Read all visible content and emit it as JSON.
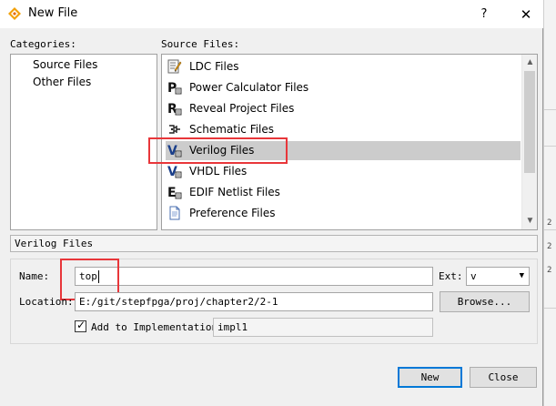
{
  "window": {
    "title": "New File",
    "help_label": "?",
    "close_label": "✕"
  },
  "categories": {
    "label": "Categories:",
    "items": [
      {
        "label": "Source Files"
      },
      {
        "label": "Other Files"
      }
    ]
  },
  "source_files": {
    "label": "Source Files:",
    "selected_index": 4,
    "items": [
      {
        "label": "LDC Files",
        "icon": "ldc-icon"
      },
      {
        "label": "Power Calculator Files",
        "icon": "power-calculator-icon"
      },
      {
        "label": "Reveal Project Files",
        "icon": "reveal-icon"
      },
      {
        "label": "Schematic Files",
        "icon": "schematic-icon"
      },
      {
        "label": "Verilog Files",
        "icon": "verilog-icon"
      },
      {
        "label": "VHDL Files",
        "icon": "vhdl-icon"
      },
      {
        "label": "EDIF Netlist Files",
        "icon": "edif-icon"
      },
      {
        "label": "Preference Files",
        "icon": "preference-icon"
      }
    ]
  },
  "description": "Verilog Files",
  "form": {
    "name_label": "Name:",
    "name_value": "top",
    "ext_label": "Ext:",
    "ext_value": "v",
    "location_label": "Location:",
    "location_value": "E:/git/stepfpga/proj/chapter2/2-1",
    "browse_label": "Browse...",
    "add_to_impl_label": "Add to Implementation",
    "add_to_impl_checked": true,
    "impl_value": "impl1"
  },
  "buttons": {
    "new_label": "New",
    "close_label": "Close"
  },
  "background_marks": [
    "2",
    "2",
    "2"
  ],
  "colors": {
    "selection": "#cccccc",
    "highlight_annotation": "#e8363a",
    "default_button_border": "#0078d7"
  }
}
